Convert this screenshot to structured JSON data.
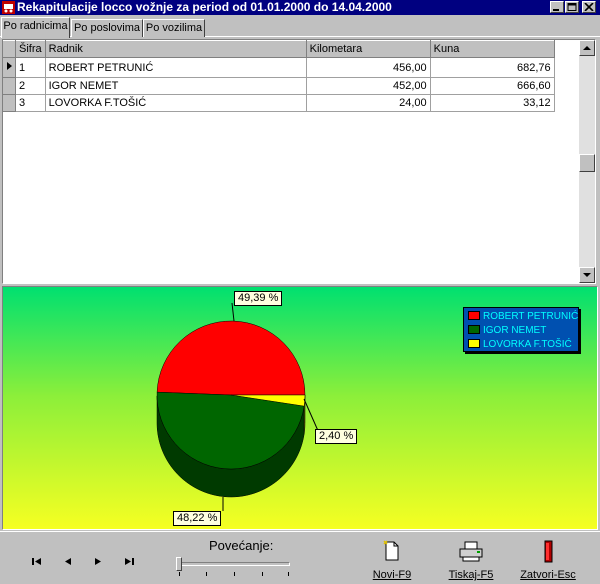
{
  "window": {
    "title": "Rekapitulacije locco vožnje za period od 01.01.2000 do 14.04.2000",
    "icon": "car-icon"
  },
  "tabs": [
    {
      "label": "Po radnicima",
      "active": true
    },
    {
      "label": "Po poslovima",
      "active": false
    },
    {
      "label": "Po vozilima",
      "active": false
    }
  ],
  "grid": {
    "columns": [
      "Šifra",
      "Radnik",
      "Kilometara",
      "Kuna"
    ],
    "rows": [
      {
        "sifra": "1",
        "radnik": "ROBERT PETRUNIĆ",
        "kilometara": "456,00",
        "kuna": "682,76",
        "current": true
      },
      {
        "sifra": "2",
        "radnik": "IGOR NEMET",
        "kilometara": "452,00",
        "kuna": "666,60",
        "current": false
      },
      {
        "sifra": "3",
        "radnik": "LOVORKA F.TOŠIĆ",
        "kilometara": "24,00",
        "kuna": "33,12",
        "current": false
      }
    ]
  },
  "chart_data": {
    "type": "pie",
    "title": "",
    "labels": [
      "ROBERT PETRUNIĆ",
      "IGOR NEMET",
      "LOVORKA F.TOŠIĆ"
    ],
    "values": [
      49.39,
      48.22,
      2.4
    ],
    "value_labels": [
      "49,39 %",
      "48,22 %",
      "2,40 %"
    ],
    "colors": [
      "#ff0000",
      "#006600",
      "#ffff00"
    ],
    "style": "3d",
    "legend": {
      "position": "top-right",
      "entries": [
        "ROBERT PETRUNIĆ",
        "IGOR NEMET",
        "LOVORKA F.TOŠIĆ"
      ]
    }
  },
  "bottom": {
    "zoom_label": "Povećanje:",
    "zoom_value": 0,
    "nav": [
      "first-icon",
      "prev-icon",
      "next-icon",
      "last-icon"
    ],
    "buttons": {
      "new": {
        "label": "Novi-F9",
        "icon": "new-document-icon"
      },
      "print": {
        "label": "Tiskaj-F5",
        "icon": "printer-icon"
      },
      "close": {
        "label": "Zatvori-Esc",
        "icon": "exit-door-icon"
      }
    }
  }
}
